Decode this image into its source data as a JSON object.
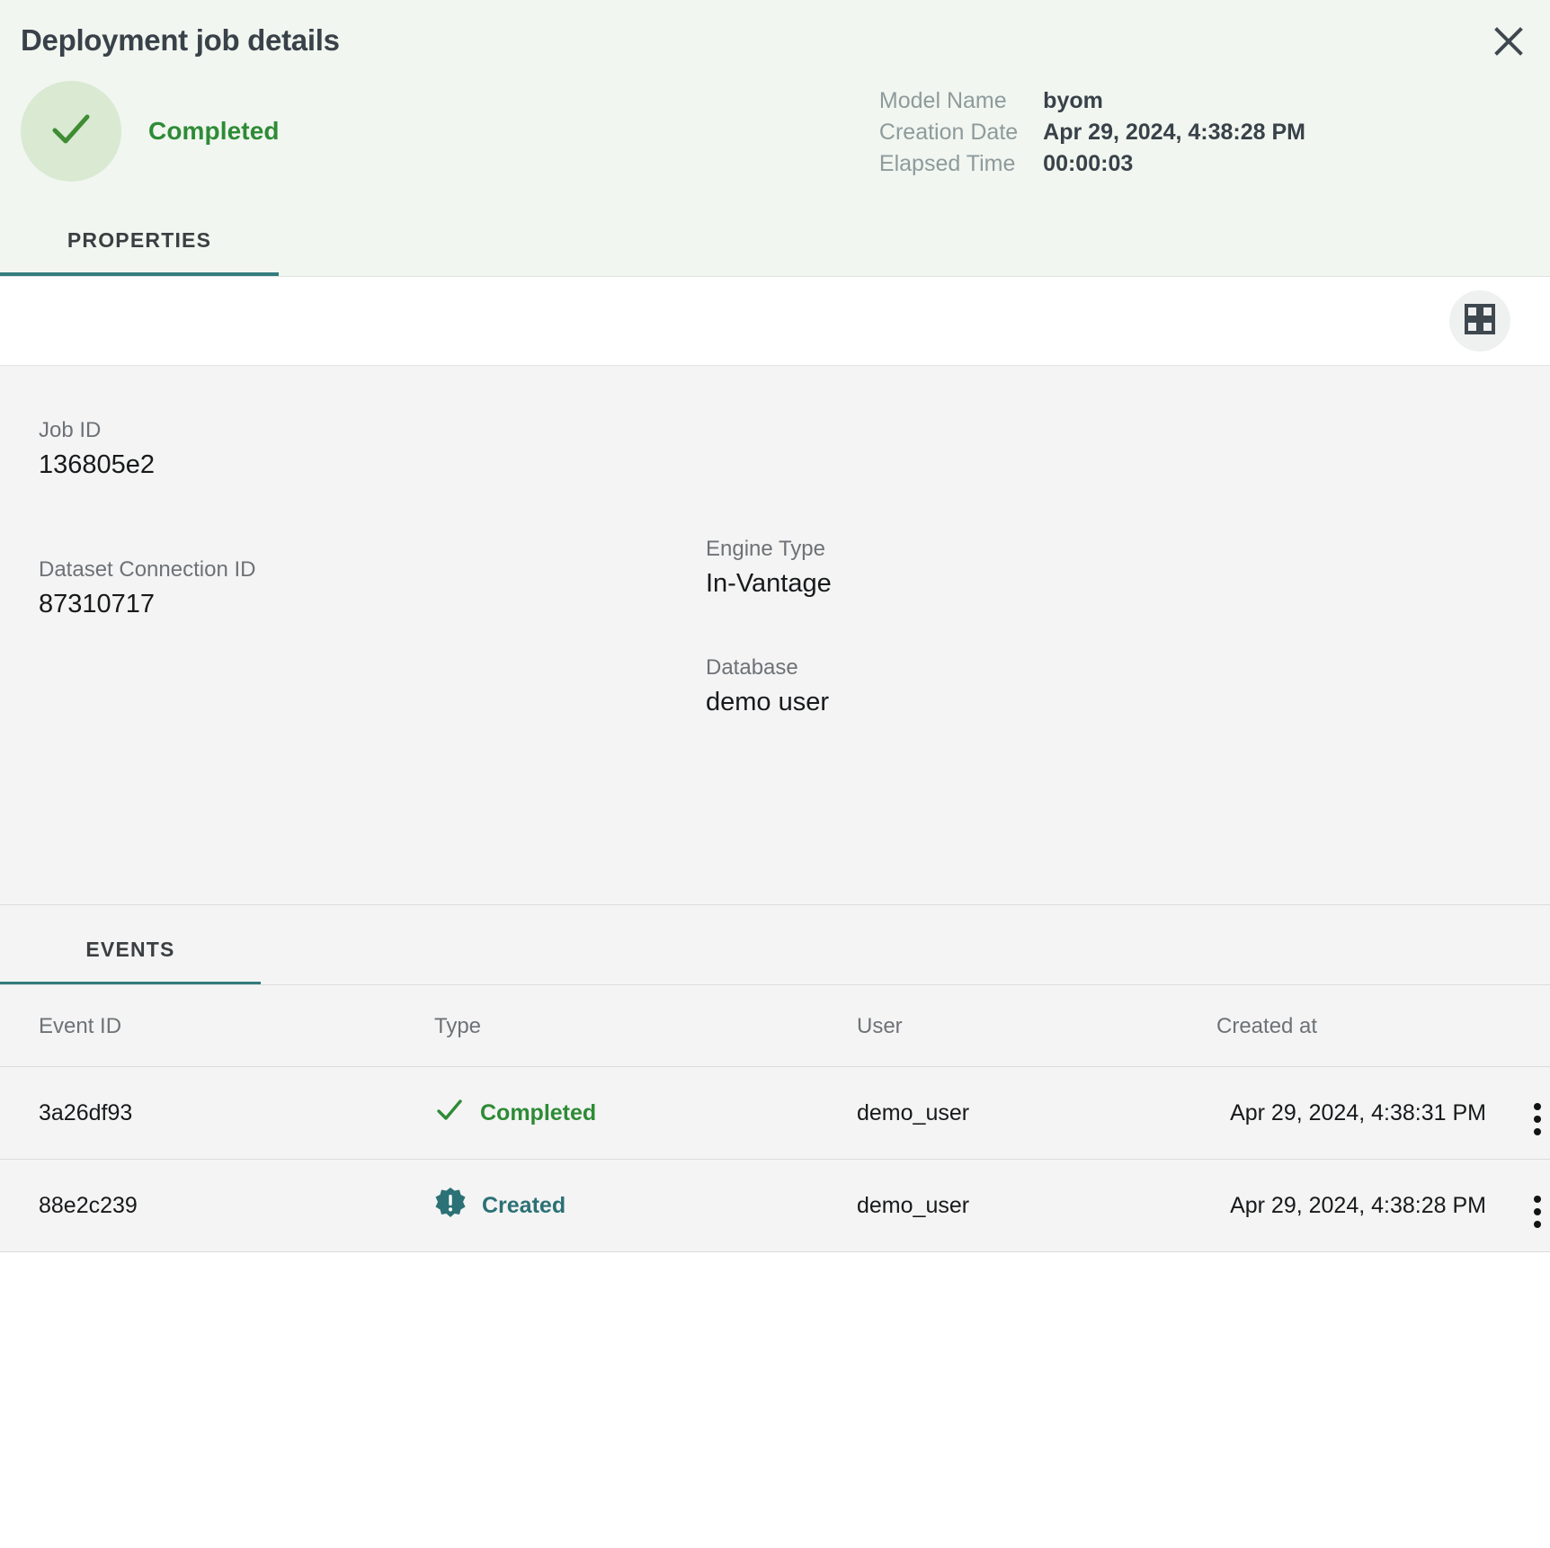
{
  "header": {
    "title": "Deployment job details",
    "close_icon": "close-icon",
    "status": {
      "label": "Completed",
      "icon": "check-icon",
      "color": "#2e8b36",
      "circle_color": "#d9e9d2"
    },
    "meta": [
      {
        "label": "Model Name",
        "value": "byom"
      },
      {
        "label": "Creation Date",
        "value": "Apr 29, 2024, 4:38:28 PM"
      },
      {
        "label": "Elapsed Time",
        "value": "00:00:03"
      }
    ],
    "tabs": [
      {
        "label": "PROPERTIES",
        "active": true
      }
    ]
  },
  "toolbar": {
    "grid_view_icon": "grid-view-icon"
  },
  "properties": {
    "left": [
      {
        "label": "Job ID",
        "value": "136805e2"
      },
      {
        "label": "Dataset Connection ID",
        "value": "87310717"
      }
    ],
    "right": [
      {
        "label": "Engine Type",
        "value": "In-Vantage"
      },
      {
        "label": "Database",
        "value": "demo user"
      }
    ]
  },
  "events": {
    "tabs": [
      {
        "label": "EVENTS",
        "active": true
      }
    ],
    "columns": [
      "Event ID",
      "Type",
      "User",
      "Created at"
    ],
    "rows": [
      {
        "event_id": "3a26df93",
        "type": "Completed",
        "type_icon": "check-icon",
        "type_color": "#2e8b36",
        "user": "demo_user",
        "created_at": "Apr 29, 2024, 4:38:31 PM",
        "menu_icon": "kebab-menu-icon"
      },
      {
        "event_id": "88e2c239",
        "type": "Created",
        "type_icon": "exclamation-badge-icon",
        "type_color": "#2b7175",
        "user": "demo_user",
        "created_at": "Apr 29, 2024, 4:38:28 PM",
        "menu_icon": "kebab-menu-icon"
      }
    ]
  },
  "colors": {
    "accent_teal": "#337c7e",
    "success_green": "#2e8b36",
    "header_bg": "#f1f6f0",
    "body_bg": "#f4f4f4"
  }
}
